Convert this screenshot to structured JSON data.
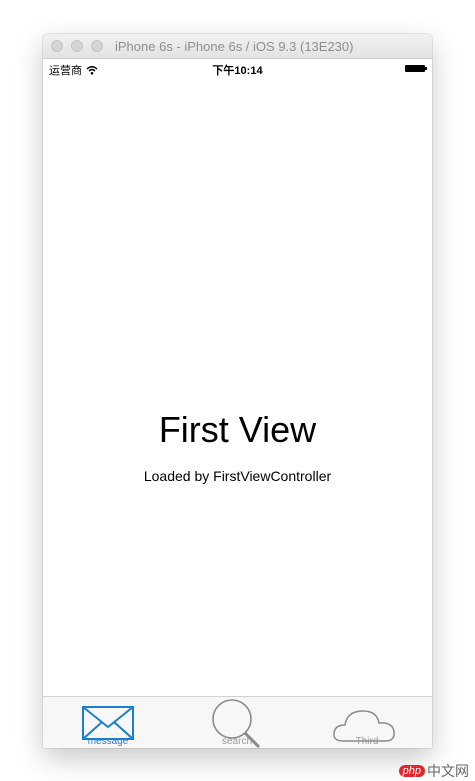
{
  "window": {
    "title": "iPhone 6s - iPhone 6s / iOS 9.3 (13E230)"
  },
  "status_bar": {
    "carrier": "运营商",
    "time": "下午10:14"
  },
  "content": {
    "title": "First View",
    "subtitle": "Loaded by FirstViewController"
  },
  "tabs": [
    {
      "label": "message",
      "icon": "envelope-icon",
      "selected": true
    },
    {
      "label": "search",
      "icon": "magnifier-icon",
      "selected": false
    },
    {
      "label": "Third",
      "icon": "cloud-icon",
      "selected": false
    }
  ],
  "colors": {
    "tint": "#1a7fcf",
    "inactive": "#9a9a9a"
  },
  "watermark": {
    "badge": "php",
    "text": "中文网"
  }
}
